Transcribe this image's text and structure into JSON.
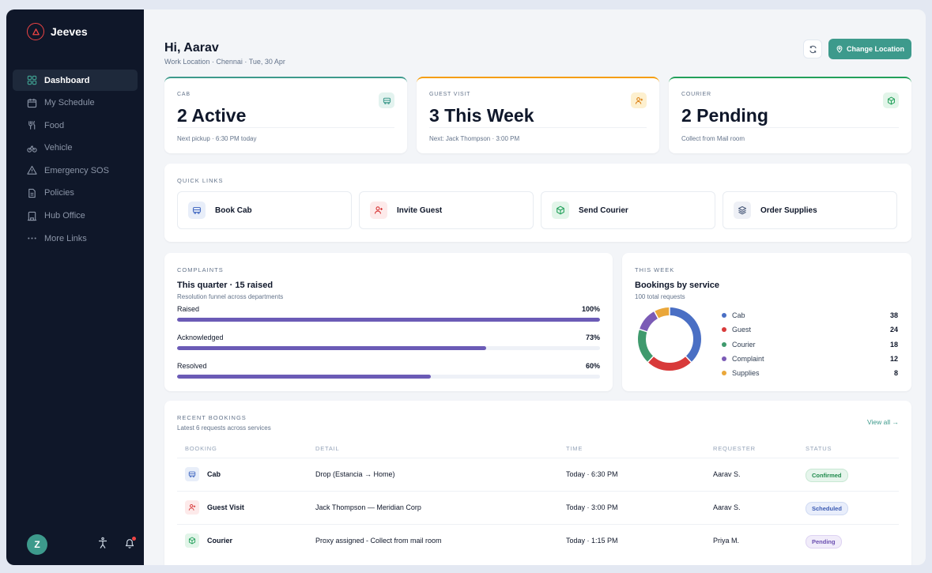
{
  "sidebar": {
    "brand": "Jeeves",
    "items": [
      {
        "label": "Dashboard",
        "icon": "grid-icon",
        "active": true
      },
      {
        "label": "My Schedule",
        "icon": "calendar-icon"
      },
      {
        "label": "Food",
        "icon": "utensils-icon"
      },
      {
        "label": "Vehicle",
        "icon": "bicycle-icon"
      },
      {
        "label": "Emergency SOS",
        "icon": "warning-icon"
      },
      {
        "label": "Policies",
        "icon": "document-icon"
      },
      {
        "label": "Hub Office",
        "icon": "building-icon"
      },
      {
        "label": "More Links",
        "icon": "dots-icon"
      }
    ],
    "avatar_initial": "Z"
  },
  "header": {
    "greeting": "Hi, Aarav",
    "subtitle": "Work Location · Chennai · Tue, 30 Apr",
    "change_location_label": "Change Location"
  },
  "stats": [
    {
      "label": "CAB",
      "value": "2 Active",
      "note": "Next pickup · 6:30 PM today",
      "accent": "#3d9a8c",
      "icon": "cab-icon"
    },
    {
      "label": "GUEST VISIT",
      "value": "3 This Week",
      "note": "Next: Jack Thompson · 3:00 PM",
      "accent": "#f59e0b",
      "icon": "add-user-icon"
    },
    {
      "label": "COURIER",
      "value": "2 Pending",
      "note": "Collect from Mail room",
      "accent": "#22a05a",
      "icon": "package-icon"
    }
  ],
  "quick_links": {
    "title": "QUICK LINKS",
    "items": [
      {
        "label": "Book Cab",
        "icon": "cab-icon"
      },
      {
        "label": "Invite Guest",
        "icon": "add-user-icon"
      },
      {
        "label": "Send Courier",
        "icon": "package-icon"
      },
      {
        "label": "Order Supplies",
        "icon": "layers-icon"
      }
    ]
  },
  "complaints": {
    "title": "COMPLAINTS",
    "heading": "This quarter · 15 raised",
    "subtitle": "Resolution funnel across departments",
    "rows": [
      {
        "label": "Raised",
        "pct_label": "100%",
        "value": 100
      },
      {
        "label": "Acknowledged",
        "pct_label": "73%",
        "value": 73
      },
      {
        "label": "Resolved",
        "pct_label": "60%",
        "value": 60
      }
    ]
  },
  "this_week": {
    "title": "THIS WEEK",
    "heading": "Bookings by service",
    "subtitle": "100 total requests"
  },
  "chart_data": {
    "type": "pie",
    "categories": [
      "Cab",
      "Guest",
      "Courier",
      "Complaint",
      "Supplies"
    ],
    "values": [
      38,
      24,
      18,
      12,
      8
    ],
    "colors": [
      "#4a6fc4",
      "#d83a3a",
      "#3f9a6d",
      "#7b5bb6",
      "#eaa73a"
    ]
  },
  "recent_bookings": {
    "title": "RECENT BOOKINGS",
    "subtitle": "Latest 6 requests across services",
    "view_all": "View all →",
    "columns": [
      "BOOKING",
      "DETAIL",
      "TIME",
      "REQUESTER",
      "STATUS"
    ],
    "rows": [
      {
        "booking": "Cab",
        "icon": "cab-icon",
        "detail": "Drop (Estancia → Home)",
        "time": "Today · 6:30 PM",
        "requester": "Aarav S.",
        "status": "Confirmed"
      },
      {
        "booking": "Guest Visit",
        "icon": "add-user-icon",
        "detail": "Jack Thompson — Meridian Corp",
        "time": "Today · 3:00 PM",
        "requester": "Aarav S.",
        "status": "Scheduled"
      },
      {
        "booking": "Courier",
        "icon": "package-icon",
        "detail": "Proxy assigned - Collect from mail room",
        "time": "Today · 1:15 PM",
        "requester": "Priya M.",
        "status": "Pending"
      }
    ]
  }
}
